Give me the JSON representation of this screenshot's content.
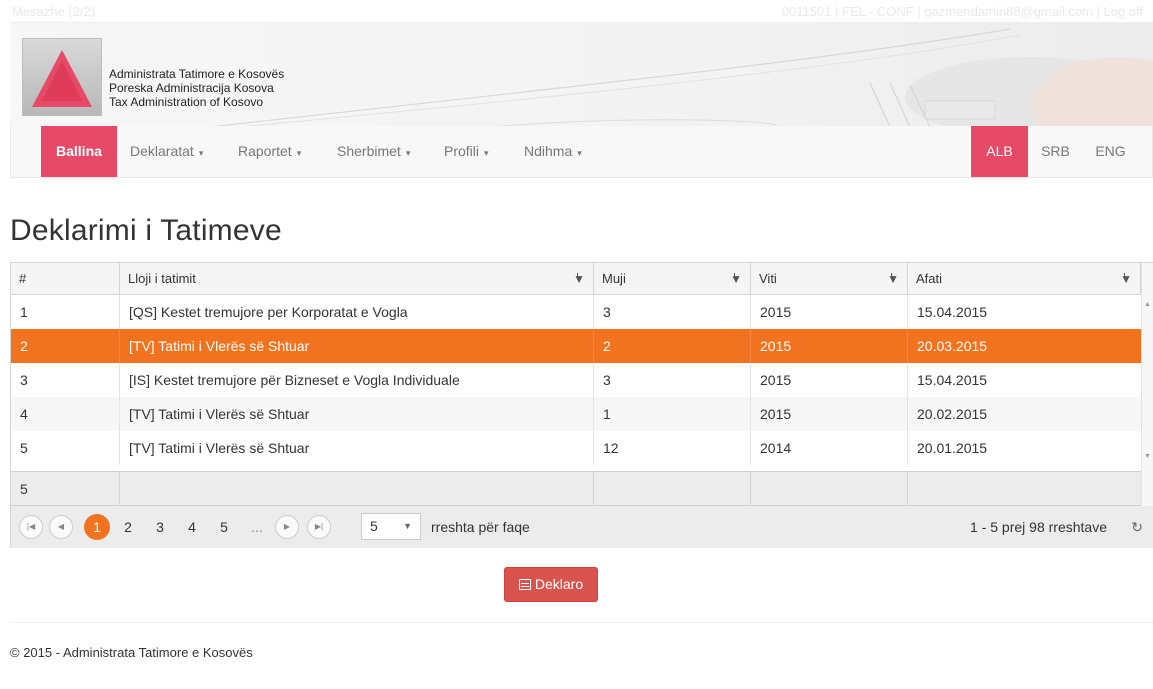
{
  "topbar": {
    "left_text": "Mesazhe (2/2)",
    "right_text": "0011501 | FEL - CONF | gazmendamiri88@gmail.com | Log off"
  },
  "header": {
    "org_lines": [
      "Administrata Tatimore e Kosovës",
      "Poreska Administracija Kosova",
      "Tax Administration of Kosovo"
    ]
  },
  "nav": {
    "items": [
      {
        "label": "Ballina",
        "dropdown": false,
        "active": true
      },
      {
        "label": "Deklaratat",
        "dropdown": true
      },
      {
        "label": "Raportet",
        "dropdown": true
      },
      {
        "label": "Sherbimet",
        "dropdown": true
      },
      {
        "label": "Profili",
        "dropdown": true
      },
      {
        "label": "Ndihma",
        "dropdown": true
      }
    ],
    "caret": "▾",
    "languages": [
      {
        "label": "ALB",
        "active": true
      },
      {
        "label": "SRB"
      },
      {
        "label": "ENG"
      }
    ]
  },
  "page": {
    "title": "Deklarimi i Tatimeve"
  },
  "grid": {
    "columns": [
      "#",
      "Lloji i tatimit",
      "Muji",
      "Viti",
      "Afati"
    ],
    "filter_icon": "filter-icon",
    "rows": [
      [
        "1",
        "[QS] Kestet tremujore per Korporatat e Vogla",
        "3",
        "2015",
        "15.04.2015"
      ],
      [
        "2",
        "[TV] Tatimi i Vlerës së Shtuar",
        "2",
        "2015",
        "20.03.2015"
      ],
      [
        "3",
        "[IS] Kestet tremujore për Bizneset e Vogla Individuale",
        "3",
        "2015",
        "15.04.2015"
      ],
      [
        "4",
        "[TV] Tatimi i Vlerës së Shtuar",
        "1",
        "2015",
        "20.02.2015"
      ],
      [
        "5",
        "[TV] Tatimi i Vlerës së Shtuar",
        "12",
        "2014",
        "20.01.2015"
      ]
    ],
    "selected_row": 1,
    "footer_count": "5"
  },
  "pager": {
    "pages": [
      "1",
      "2",
      "3",
      "4",
      "5",
      "..."
    ],
    "current": "1",
    "page_size": "5",
    "page_size_label": "rreshta për faqe",
    "info": "1 - 5 prej 98 rreshtave"
  },
  "actions": {
    "declare_label": "Deklaro"
  },
  "footer": {
    "copyright": "© 2015 - Administrata Tatimore e Kosovës"
  },
  "colors": {
    "accent_pink": "#e64a67",
    "selection_orange": "#f2731f",
    "button_red": "#d9534f"
  }
}
